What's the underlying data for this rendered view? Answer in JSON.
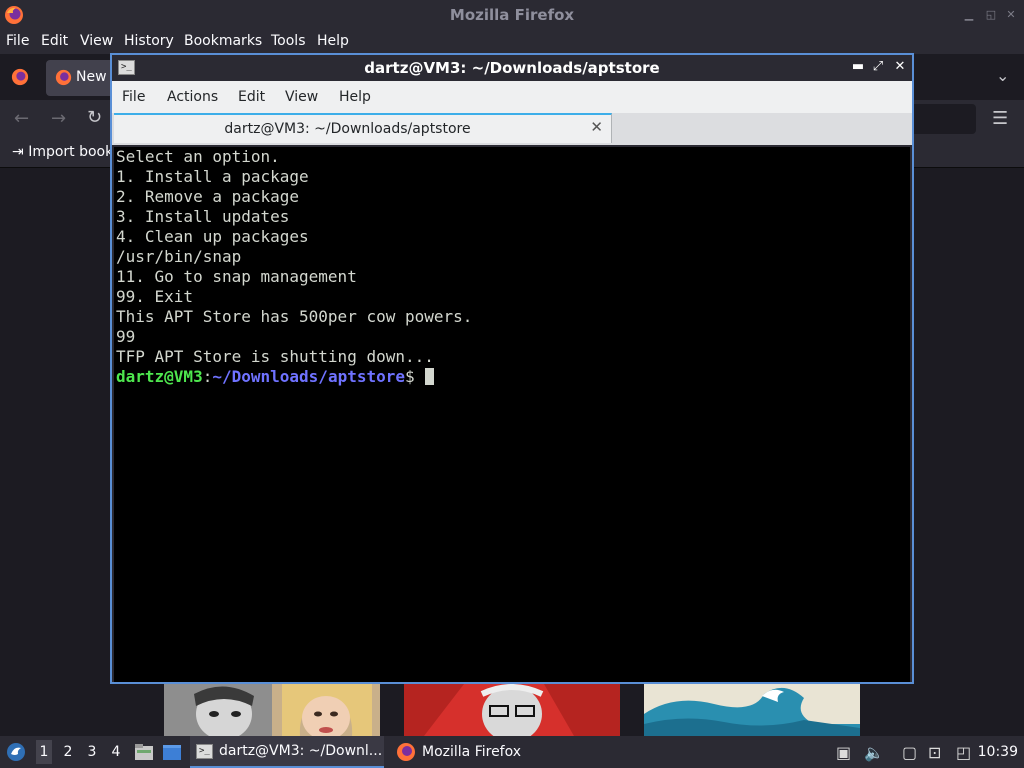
{
  "firefox": {
    "title": "Mozilla Firefox",
    "menu": [
      "File",
      "Edit",
      "View",
      "History",
      "Bookmarks",
      "Tools",
      "Help"
    ],
    "tab_label": "New",
    "import_bookmarks": "Import book",
    "icons": [
      "back-icon",
      "forward-icon",
      "reload-icon",
      "hamburger-menu-icon",
      "tab-list-chevron-icon"
    ]
  },
  "terminal": {
    "title": "dartz@VM3: ~/Downloads/aptstore",
    "menu": [
      "File",
      "Actions",
      "Edit",
      "View",
      "Help"
    ],
    "tab_label": "dartz@VM3: ~/Downloads/aptstore",
    "output_lines": [
      "Select an option.",
      "1. Install a package",
      "2. Remove a package",
      "3. Install updates",
      "4. Clean up packages",
      "/usr/bin/snap",
      "11. Go to snap management",
      "99. Exit",
      "This APT Store has 500per cow powers.",
      "99",
      "TFP APT Store is shutting down..."
    ],
    "prompt": {
      "user_host": "dartz@VM3",
      "separator": ":",
      "path": "~/Downloads/aptstore",
      "symbol": "$"
    },
    "colors": {
      "prompt_user": "#4ee64e",
      "prompt_path": "#6f72ff",
      "text": "#d3d7cf",
      "background": "#000000",
      "accent": "#5a8fd6"
    }
  },
  "taskbar": {
    "workspaces": [
      "1",
      "2",
      "3",
      "4"
    ],
    "active_workspace": "1",
    "tasks": [
      {
        "label": "dartz@VM3: ~/Downl...",
        "icon": "terminal-icon",
        "active": true
      },
      {
        "label": "Mozilla Firefox",
        "icon": "firefox-icon",
        "active": false
      }
    ],
    "clock": "10:39",
    "tray_icons": [
      "clipboard-icon",
      "volume-icon",
      "notes-icon",
      "network-icon",
      "notification-icon"
    ]
  }
}
